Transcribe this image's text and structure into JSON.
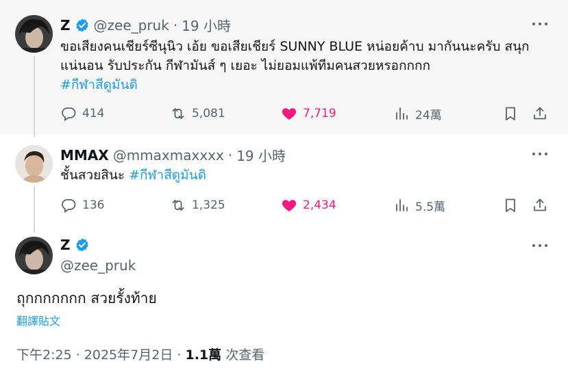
{
  "tweets": [
    {
      "name": "Z",
      "handle": "@zee_pruk",
      "time": "19 小時",
      "text_lines": [
        "ขอเสียงคนเชียร์ซีนุนิว เอ้ย ขอเสียเชียร์ SUNNY BLUE หน่อยค้าบ มากันนะครับ สนุก",
        "แน่นอน รับประกัน กีฬามันส์ ๆ เยอะ ไม่ยอมแพ้ทีมคนสวยหรอกกกก"
      ],
      "hashtag": "#กีฬาสีดูมันดิ",
      "replies": "414",
      "retweets": "5,081",
      "likes": "7,719",
      "views": "24萬"
    },
    {
      "name": "MMAX",
      "handle": "@mmaxmaxxxx",
      "time": "19 小時",
      "text": "ชั้นสวยสินะ",
      "hashtag": "#กีฬาสีดูมันดิ",
      "replies": "136",
      "retweets": "1,325",
      "likes": "2,434",
      "views": "5.5萬"
    },
    {
      "name": "Z",
      "handle": "@zee_pruk",
      "text": "ถุกกกกกกก สวยรั้งท้าย",
      "translate": "翻譯貼文",
      "time_full": "下午2:25 · 2025年7月2日",
      "views_count": "1.1萬",
      "views_label": "次查看"
    }
  ],
  "separator": "·",
  "colors": {
    "accent": "#1d9bf0",
    "like": "#f91880",
    "muted": "#536471",
    "highlight_bg": "#f7f7f7"
  },
  "icons": [
    "verified-badge-icon",
    "more-icon",
    "reply-icon",
    "retweet-icon",
    "heart-icon",
    "views-icon",
    "bookmark-icon",
    "share-icon"
  ]
}
